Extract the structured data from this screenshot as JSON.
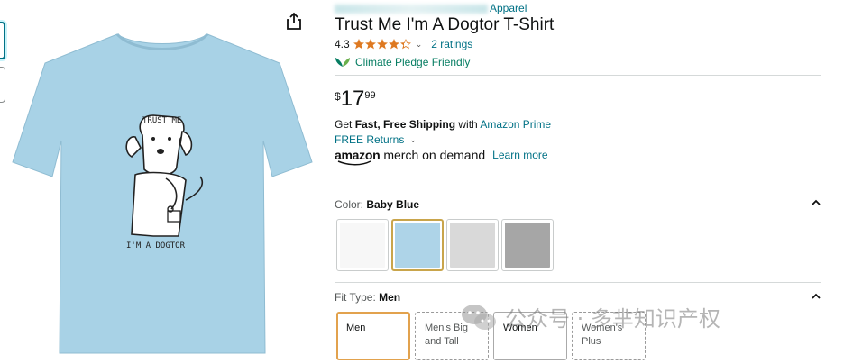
{
  "product": {
    "brand_suffix": "Apparel",
    "title": "Trust Me I'm A Dogtor T-Shirt",
    "rating_value": "4.3",
    "stars_filled": 4.3,
    "ratings_count": "2 ratings",
    "climate_pledge": "Climate Pledge Friendly"
  },
  "image": {
    "shirt_color": "#a8d2e6",
    "print_text_top": "TRUST ME",
    "print_text_bottom": "I'M A DOGTOR"
  },
  "price": {
    "symbol": "$",
    "whole": "17",
    "fraction": "99"
  },
  "shipping": {
    "prefix": "Get ",
    "bold": "Fast, Free Shipping",
    "middle": " with ",
    "prime_link": "Amazon Prime",
    "free_returns": "FREE Returns"
  },
  "merch": {
    "logo": "amazon",
    "tagline": "merch on demand",
    "learn_more": "Learn more"
  },
  "color": {
    "label": "Color: ",
    "selected": "Baby Blue",
    "swatches": [
      {
        "name": "white",
        "hex": "#f7f7f7"
      },
      {
        "name": "baby-blue",
        "hex": "#aed4e8"
      },
      {
        "name": "silver",
        "hex": "#d9d9d9"
      },
      {
        "name": "heather-grey",
        "hex": "#a6a6a6"
      }
    ]
  },
  "fit": {
    "label": "Fit Type: ",
    "selected": "Men",
    "options": [
      {
        "line1": "Men",
        "line2": ""
      },
      {
        "line1": "Men's Big",
        "line2": "and Tall"
      },
      {
        "line1": "Women",
        "line2": ""
      },
      {
        "line1": "Women's",
        "line2": "Plus"
      }
    ]
  },
  "watermark": {
    "text": "公众号 · 多芈知识产权"
  },
  "colors": {
    "link": "#007185",
    "star": "#de7921",
    "pledge": "#067d62",
    "selected_swatch_border": "#c9a54b",
    "selected_fit_border": "#e2a24d"
  }
}
